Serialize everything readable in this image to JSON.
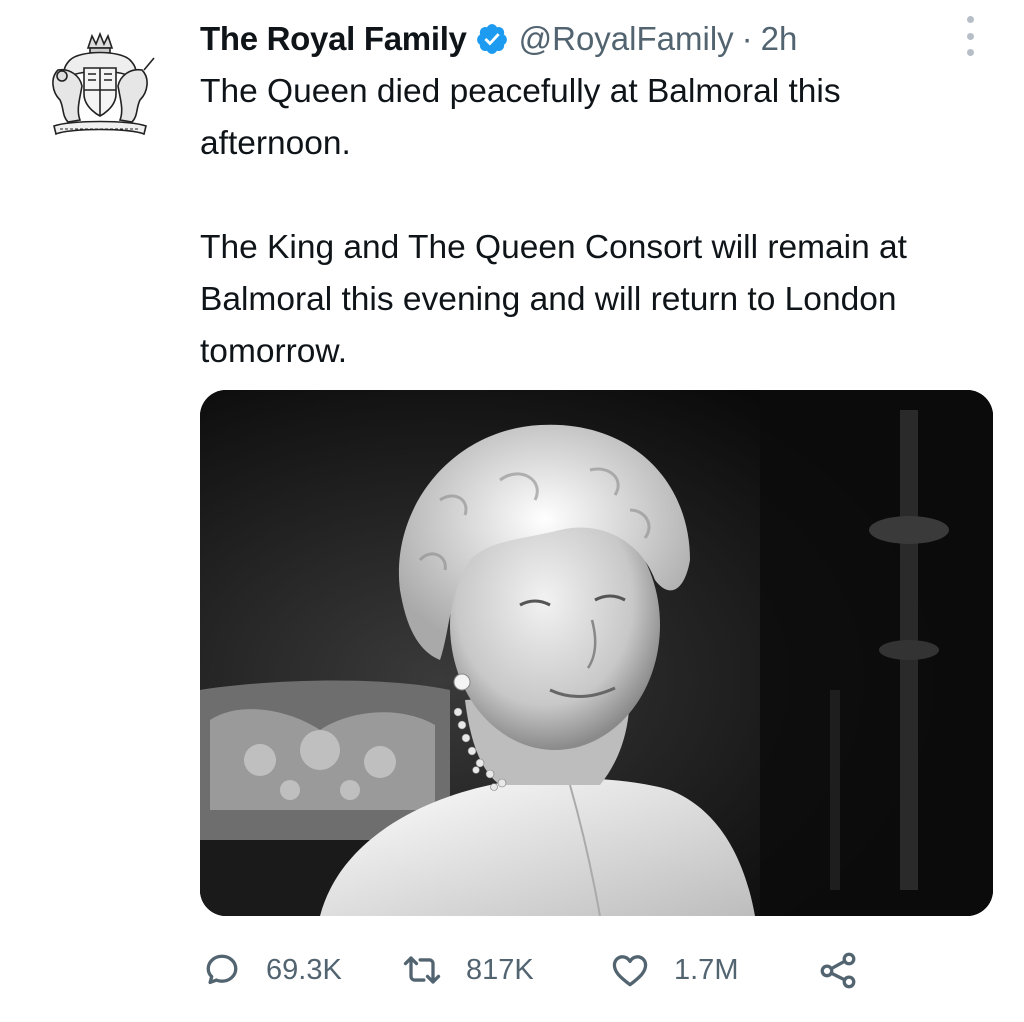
{
  "tweet": {
    "author_name": "The Royal Family",
    "handle": "@RoyalFamily",
    "separator": "·",
    "time": "2h",
    "paragraphs": [
      "The Queen died peacefully at Balmoral this afternoon.",
      "The King and The Queen Consort will remain at Balmoral this evening and will return to London tomorrow."
    ],
    "avatar_icon": "royal-coat-of-arms",
    "media_icon": "portrait-photo"
  },
  "actions": {
    "reply": {
      "icon": "reply-icon",
      "count": "69.3K"
    },
    "retweet": {
      "icon": "retweet-icon",
      "count": "817K"
    },
    "like": {
      "icon": "heart-icon",
      "count": "1.7M"
    },
    "share": {
      "icon": "share-icon"
    }
  },
  "colors": {
    "text": "#0f1419",
    "secondary": "#536471",
    "verified": "#1d9bf0"
  }
}
